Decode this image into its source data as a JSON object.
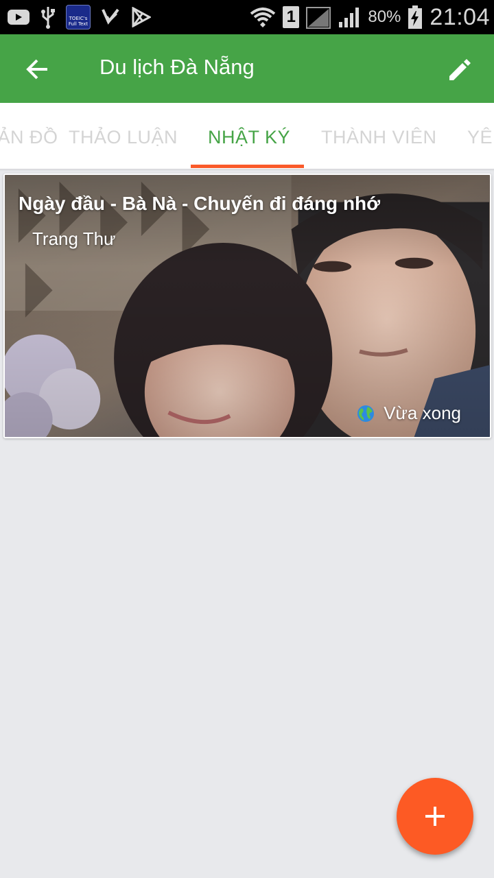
{
  "status_bar": {
    "toeic_app_label": "TOEIC's Full Text",
    "sim_slot": "1",
    "battery_percent": "80%",
    "time": "21:04"
  },
  "app_bar": {
    "title": "Du lịch Đà Nẵng"
  },
  "tabs": [
    {
      "label": "BẢN ĐỒ",
      "active": false
    },
    {
      "label": "THẢO LUẬN",
      "active": false
    },
    {
      "label": "NHẬT KÝ",
      "active": true
    },
    {
      "label": "THÀNH VIÊN",
      "active": false
    },
    {
      "label": "YÊU",
      "active": false
    }
  ],
  "journal_entries": [
    {
      "title": "Ngày đầu - Bà Nà - Chuyến đi đáng nhớ",
      "author": "Trang Thư",
      "time": "Vừa xong",
      "privacy_icon": "globe-icon"
    }
  ],
  "fab": {
    "icon": "plus-icon"
  },
  "colors": {
    "primary": "#46a447",
    "accent": "#fd5a24",
    "background": "#e8e9ec"
  }
}
